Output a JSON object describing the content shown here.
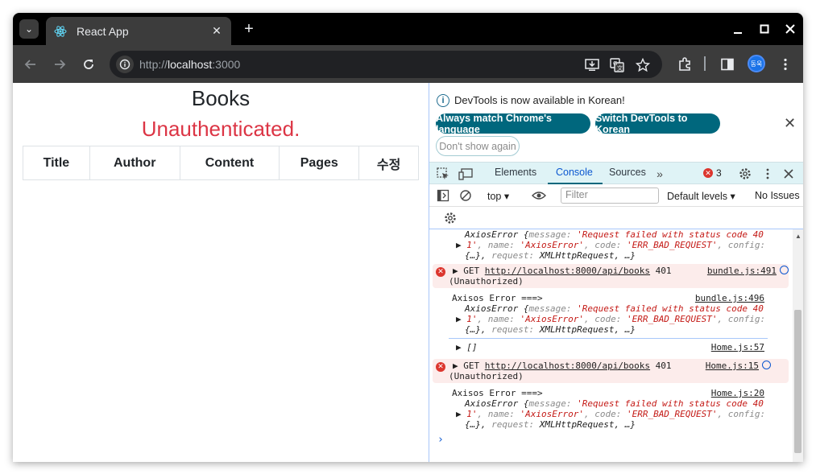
{
  "browser": {
    "tab_title": "React App",
    "url_scheme": "http://",
    "url_host": "localhost",
    "url_port": ":3000",
    "avatar_text": "동욱"
  },
  "page": {
    "title": "Books",
    "error": "Unauthenticated.",
    "columns": [
      "Title",
      "Author",
      "Content",
      "Pages",
      "수정"
    ]
  },
  "devtools": {
    "info_text": "DevTools is now available in Korean!",
    "btn_match": "Always match Chrome's language",
    "btn_switch": "Switch DevTools to Korean",
    "btn_dont_show": "Don't show again",
    "tabs": [
      "Elements",
      "Console",
      "Sources"
    ],
    "active_tab": "Console",
    "error_count": "3",
    "context": "top",
    "filter_placeholder": "Filter",
    "levels": "Default levels",
    "issues": "No Issues",
    "messages": [
      {
        "label": "",
        "obj_head": "AxiosError {",
        "obj_l1_a": "message: ",
        "obj_l1_b": "'Request failed with status code 40",
        "obj_l2_a": "1'",
        "obj_l2_b": ", name: ",
        "obj_l2_c": "'AxiosError'",
        "obj_l2_d": ", code: ",
        "obj_l2_e": "'ERR_BAD_REQUEST'",
        "obj_l2_f": ", config:",
        "obj_l3_a": "{…}, ",
        "obj_l3_b": "request: ",
        "obj_l3_c": "XMLHttpRequest, …}"
      },
      {
        "type": "error",
        "method": "GET ",
        "url": "http://localhost:8000/api/books",
        "status": " 401",
        "status_text": "(Unauthorized)",
        "source": "bundle.js:491"
      },
      {
        "label": "Axisos Error ===>",
        "source": "bundle.js:496"
      },
      {
        "label": "[]",
        "source": "Home.js:57"
      },
      {
        "type": "error",
        "method": "GET ",
        "url": "http://localhost:8000/api/books",
        "status": " 401",
        "status_text": "(Unauthorized)",
        "source": "Home.js:15"
      },
      {
        "label": "Axisos Error ===>",
        "source": "Home.js:20"
      }
    ]
  },
  "colors": {
    "error_red": "#dc3545",
    "devtools_accent": "#00677d",
    "console_error_bg": "#fceceb"
  }
}
